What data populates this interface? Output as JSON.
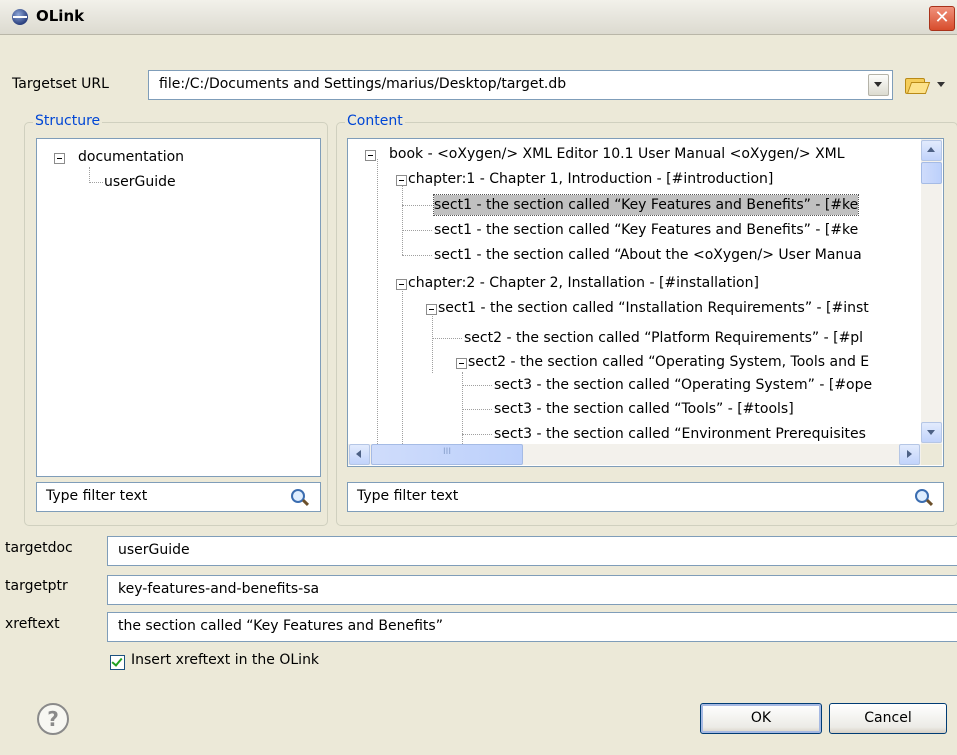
{
  "window": {
    "title": "OLink",
    "close_glyph": "✕"
  },
  "targetset": {
    "label": "Targetset URL",
    "value": "file:/C:/Documents and Settings/marius/Desktop/target.db"
  },
  "structure": {
    "title": "Structure",
    "items": [
      "documentation",
      "userGuide"
    ],
    "filter_placeholder": "Type filter text"
  },
  "content": {
    "title": "Content",
    "items": [
      "book -  <oXygen/> XML Editor 10.1 User Manual <oXygen/> XML",
      "chapter:1 - Chapter 1, Introduction - [#introduction]",
      "sect1 - the section called “Key Features and Benefits” - [#ke",
      "sect1 - the section called “Key Features and Benefits” - [#ke",
      "sect1 - the section called “About the <oXygen/> User Manua",
      "chapter:2 - Chapter 2, Installation - [#installation]",
      "sect1 - the section called “Installation Requirements” - [#inst",
      "sect2 - the section called “Platform Requirements” - [#pl",
      "sect2 - the section called “Operating System, Tools and E",
      "sect3 - the section called “Operating System” - [#ope",
      "sect3 - the section called “Tools” - [#tools]",
      "sect3 - the section called “Environment Prerequisites"
    ],
    "hscroll_grip": "III",
    "filter_placeholder": "Type filter text"
  },
  "fields": {
    "targetdoc": {
      "label": "targetdoc",
      "value": "userGuide"
    },
    "targetptr": {
      "label": "targetptr",
      "value": "key-features-and-benefits-sa"
    },
    "xreftext": {
      "label": "xreftext",
      "value": "the section called “Key Features and Benefits”"
    }
  },
  "insert_xreftext": {
    "label": "Insert xreftext in the OLink",
    "checked": true
  },
  "buttons": {
    "help": "?",
    "ok": "OK",
    "cancel": "Cancel"
  },
  "icons": [
    "oxygen-app-icon",
    "close-icon",
    "dropdown-arrow-icon",
    "folder-open-icon",
    "caret-down-icon",
    "search-icon",
    "help-icon",
    "checkmark-icon"
  ]
}
